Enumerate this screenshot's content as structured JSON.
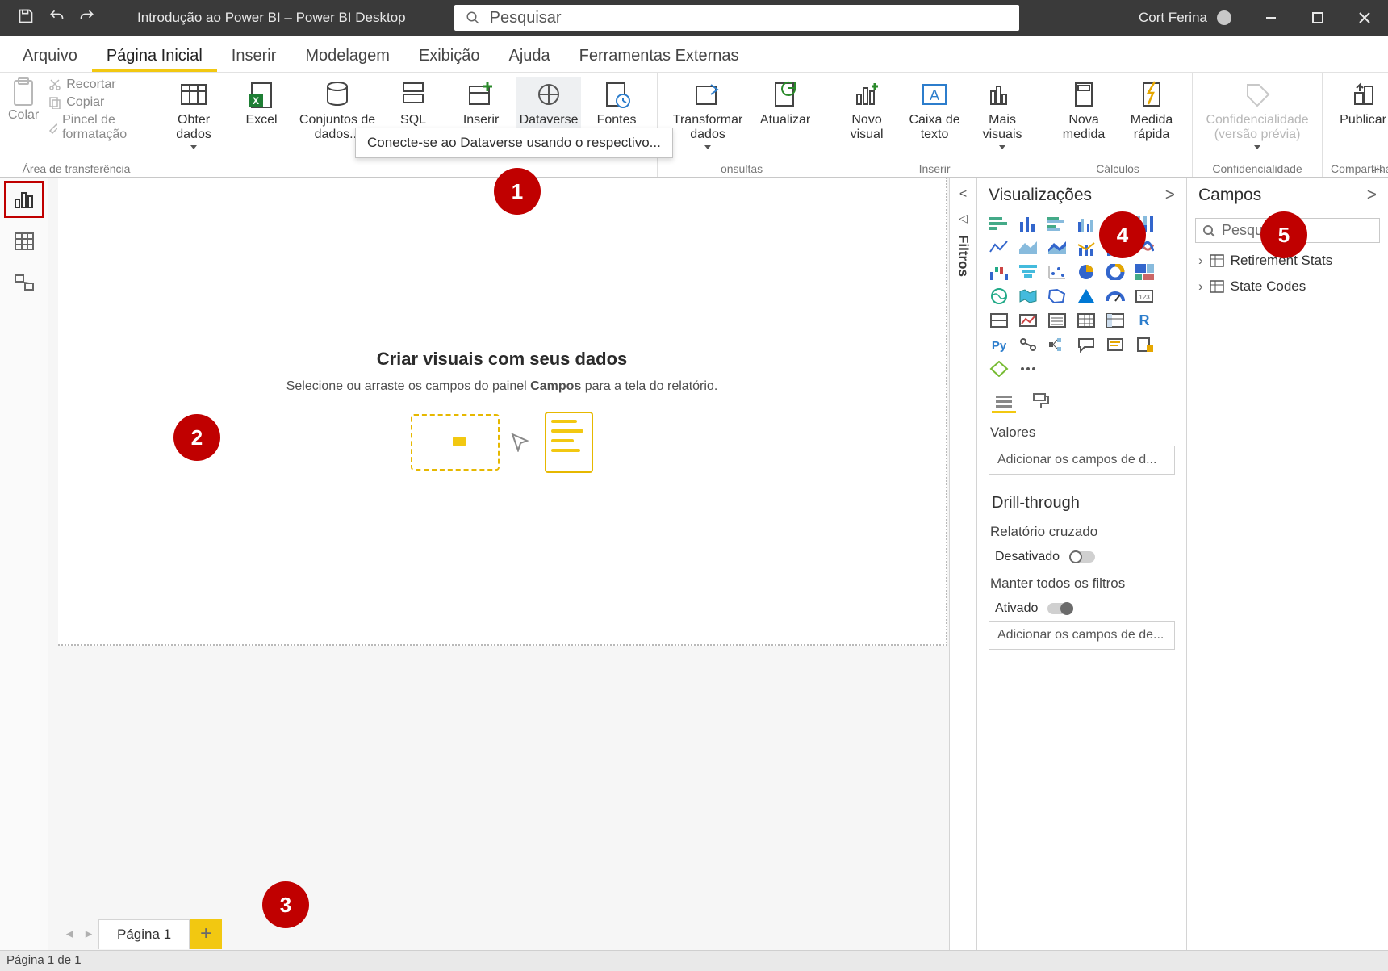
{
  "titleBar": {
    "appTitle": "Introdução ao Power BI – Power BI Desktop",
    "searchPlaceholder": "Pesquisar",
    "userName": "Cort Ferina"
  },
  "ribbonTabs": [
    "Arquivo",
    "Página Inicial",
    "Inserir",
    "Modelagem",
    "Exibição",
    "Ajuda",
    "Ferramentas Externas"
  ],
  "ribbonActiveTab": 1,
  "ribbonGroups": {
    "clipboard": {
      "title": "Área de transferência",
      "paste": "Colar",
      "cut": "Recortar",
      "copy": "Copiar",
      "formatPainter": "Pincel de formatação"
    },
    "data": {
      "getData": "Obter dados",
      "excel": "Excel",
      "datasets": "Conjuntos de dados...",
      "sql": "SQL Server",
      "enterData": "Inserir dados",
      "dataverse": "Dataverse",
      "recentSources": "Fontes recentes"
    },
    "queries": {
      "title": "onsultas",
      "transform": "Transformar dados",
      "refresh": "Atualizar"
    },
    "insert": {
      "title": "Inserir",
      "newVisual": "Novo visual",
      "textBox": "Caixa de texto",
      "moreVisuals": "Mais visuais"
    },
    "calc": {
      "title": "Cálculos",
      "newMeasure": "Nova medida",
      "quickMeasure": "Medida rápida"
    },
    "sensitivity": {
      "title": "Confidencialidade",
      "label": "Confidencialidade (versão prévia)"
    },
    "share": {
      "title": "Compartilhar",
      "publish": "Publicar"
    }
  },
  "tooltip": "Conecte-se ao Dataverse usando o respectivo...",
  "canvas": {
    "title": "Criar visuais com seus dados",
    "subtitlePrefix": "Selecione ou arraste os campos do painel ",
    "subtitleBold": "Campos",
    "subtitleSuffix": " para a tela do relatório."
  },
  "pageTabs": {
    "page1": "Página 1"
  },
  "filtersPanel": {
    "title": "Filtros"
  },
  "vizPanel": {
    "title": "Visualizações",
    "valuesTitle": "Valores",
    "valuesPlaceholder": "Adicionar os campos de d...",
    "drillTitle": "Drill-through",
    "crossReport": "Relatório cruzado",
    "off": "Desativado",
    "keepFilters": "Manter todos os filtros",
    "on": "Ativado",
    "drillPlaceholder": "Adicionar os campos de de..."
  },
  "fieldsPanel": {
    "title": "Campos",
    "searchPlaceholder": "Pesquisar",
    "tables": [
      "Retirement Stats",
      "State Codes"
    ]
  },
  "statusBar": "Página 1 de 1",
  "callouts": [
    "1",
    "2",
    "3",
    "4",
    "5"
  ]
}
